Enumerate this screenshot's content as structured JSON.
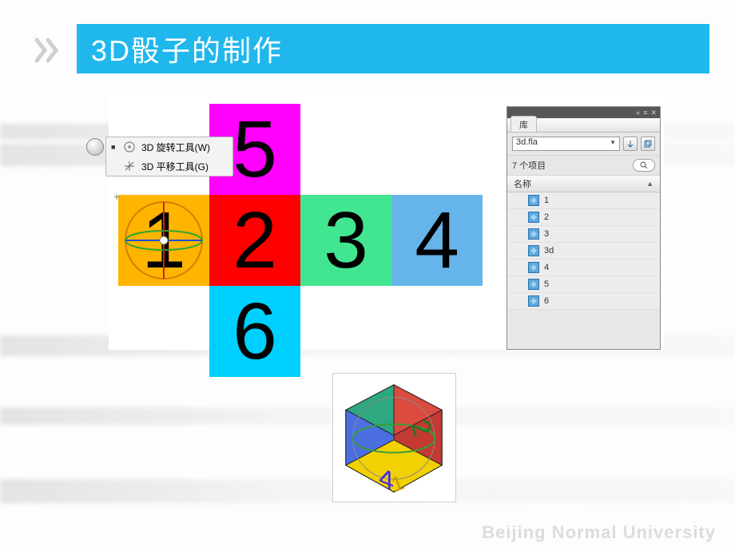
{
  "header": {
    "title": "3D骰子的制作"
  },
  "flyout": {
    "items": [
      {
        "label": "3D 旋转工具(W)",
        "selected": true
      },
      {
        "label": "3D 平移工具(G)",
        "selected": false
      }
    ]
  },
  "faces": {
    "f1": "1",
    "f2": "2",
    "f3": "3",
    "f4": "4",
    "f5": "5",
    "f6": "6",
    "colors": {
      "f1": "#ffb400",
      "f2": "#ff0000",
      "f3": "#42e690",
      "f4": "#66b5ea",
      "f5": "#ff00ff",
      "f6": "#00d0ff"
    }
  },
  "panel": {
    "tab": "库",
    "document": "3d.fla",
    "count_label": "7 个项目",
    "column_header": "名称",
    "window_controls": {
      "minimize": "«",
      "menu": "≡",
      "close": "✕"
    },
    "items": [
      {
        "name": "1",
        "type": "movieclip"
      },
      {
        "name": "2",
        "type": "movieclip"
      },
      {
        "name": "3",
        "type": "movieclip"
      },
      {
        "name": "3d",
        "type": "movieclip"
      },
      {
        "name": "4",
        "type": "movieclip"
      },
      {
        "name": "5",
        "type": "movieclip"
      },
      {
        "name": "6",
        "type": "movieclip"
      }
    ]
  },
  "watermark": "Beijing Normal University"
}
